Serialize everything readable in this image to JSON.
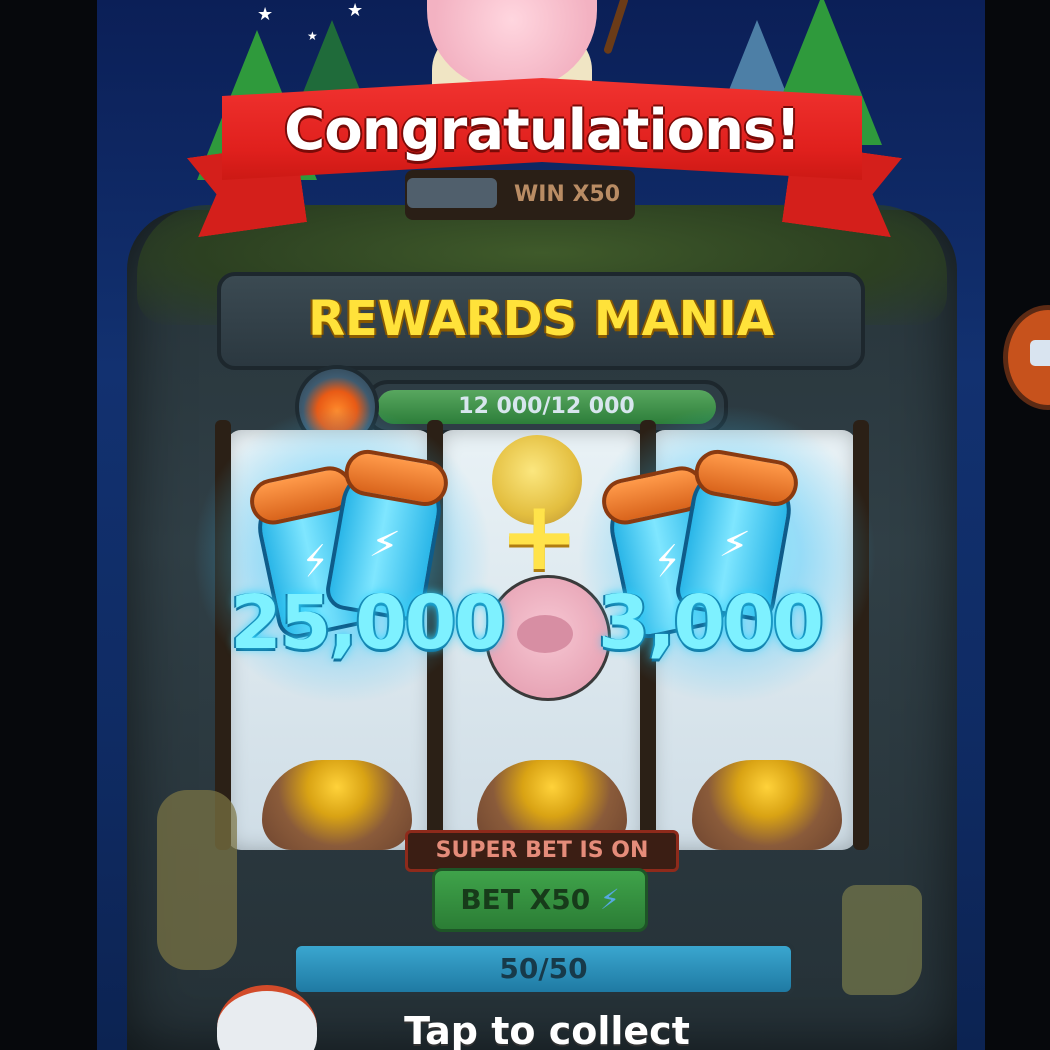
{
  "banner": {
    "text": "Congratulations!"
  },
  "machine": {
    "win_label": "WIN X50",
    "title": "REWARDS MANIA",
    "meter_text": "12 000/12 000"
  },
  "rewards": {
    "plus": "+",
    "left_amount": "25,000",
    "right_amount": "3,000"
  },
  "controls": {
    "super_bet": "SUPER BET IS ON",
    "bet_label": "BET X50",
    "bet_icon": "lightning-icon",
    "spins_text": "50/50",
    "tap_prompt": "Tap to collect"
  },
  "colors": {
    "ribbon": "#e0201d",
    "title": "#ffe23a",
    "amount": "#7ef1ff",
    "bet_button": "#3fa34a",
    "spins_bar": "#3aa6cf"
  }
}
